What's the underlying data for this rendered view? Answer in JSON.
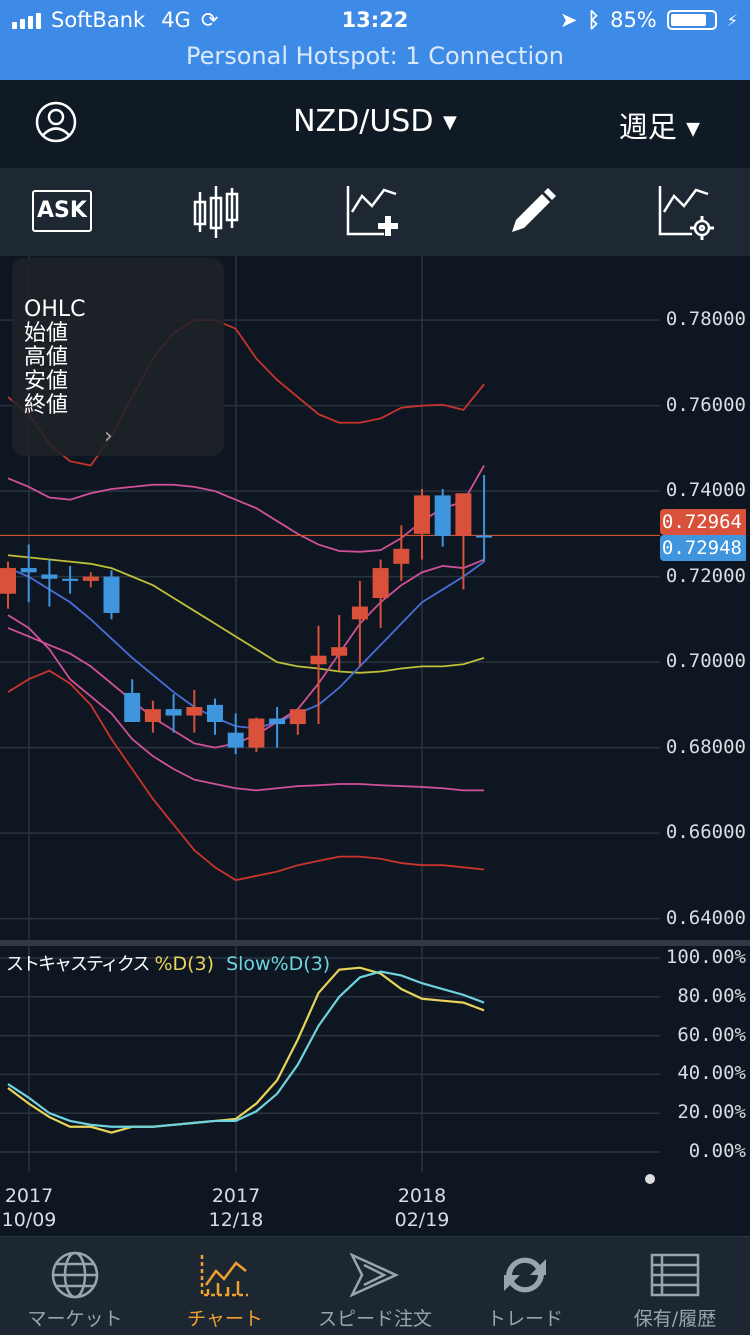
{
  "status_bar": {
    "carrier": "SoftBank",
    "network": "4G",
    "time": "13:22",
    "battery": "85%",
    "battery_level": 0.85,
    "hotspot": "Personal Hotspot: 1 Connection"
  },
  "header": {
    "pair": "NZD/USD",
    "period": "週足",
    "icons": [
      "user-icon",
      "chevron-down-icon"
    ]
  },
  "toolbar": {
    "ask_label": "ASK",
    "icons": [
      "ask-icon",
      "candlestick-icon",
      "add-indicator-icon",
      "pencil-icon",
      "chart-settings-icon"
    ]
  },
  "ohlc_panel": {
    "title": "OHLC",
    "rows": [
      "始値",
      "高値",
      "安値",
      "終値"
    ]
  },
  "price_axis": {
    "ticks": [
      "0.78000",
      "0.76000",
      "0.74000",
      "0.72000",
      "0.70000",
      "0.68000",
      "0.66000",
      "0.64000"
    ],
    "ask_tag": "0.72964",
    "bid_tag": "0.72948",
    "ask_color": "#d9513a",
    "bid_color": "#3f95de"
  },
  "oscillator": {
    "name": "ストキャスティクス",
    "d_label": "%D(3)",
    "slow_label": "Slow%D(3)",
    "d_color": "#e8d45a",
    "slow_color": "#6fd3e0",
    "ticks": [
      "100.00%",
      "80.00%",
      "60.00%",
      "40.00%",
      "20.00%",
      "0.00%"
    ]
  },
  "time_axis": [
    {
      "year": "2017",
      "date": "10/09"
    },
    {
      "year": "2017",
      "date": "12/18"
    },
    {
      "year": "2018",
      "date": "02/19"
    }
  ],
  "tabs": [
    {
      "label": "マーケット",
      "icon": "globe-icon",
      "active": false
    },
    {
      "label": "チャート",
      "icon": "chart-icon",
      "active": true
    },
    {
      "label": "スピード注文",
      "icon": "speed-order-icon",
      "active": false
    },
    {
      "label": "トレード",
      "icon": "trade-icon",
      "active": false
    },
    {
      "label": "保有/履歴",
      "icon": "history-icon",
      "active": false
    }
  ],
  "colors": {
    "up": "#d9513a",
    "down": "#3f95de",
    "active_tab": "#f0a12c",
    "status_bar": "#3d8be7"
  },
  "chart_data": {
    "type": "candlestick",
    "x": [
      "2017/09/11",
      "2017/09/18",
      "2017/09/25",
      "2017/10/02",
      "2017/10/09",
      "2017/10/16",
      "2017/10/23",
      "2017/10/30",
      "2017/11/06",
      "2017/11/13",
      "2017/11/20",
      "2017/11/27",
      "2017/12/04",
      "2017/12/11",
      "2017/12/18",
      "2017/12/25",
      "2018/01/01",
      "2018/01/08",
      "2018/01/15",
      "2018/01/22",
      "2018/01/29",
      "2018/02/05",
      "2018/02/12",
      "2018/02/19"
    ],
    "open": [
      0.716,
      0.722,
      0.7205,
      0.7195,
      0.719,
      0.72,
      0.6928,
      0.686,
      0.689,
      0.6875,
      0.69,
      0.6835,
      0.68,
      0.6868,
      0.6855,
      0.6995,
      0.7015,
      0.71,
      0.715,
      0.723,
      0.73,
      0.739,
      0.7295,
      0.7296
    ],
    "high": [
      0.7235,
      0.7275,
      0.724,
      0.7225,
      0.721,
      0.7215,
      0.696,
      0.691,
      0.6925,
      0.6935,
      0.6915,
      0.688,
      0.687,
      0.6895,
      0.6885,
      0.7085,
      0.711,
      0.719,
      0.724,
      0.732,
      0.7405,
      0.7405,
      0.7385,
      0.7438
    ],
    "low": [
      0.7125,
      0.714,
      0.713,
      0.716,
      0.7175,
      0.71,
      0.6865,
      0.6835,
      0.6835,
      0.6835,
      0.683,
      0.6785,
      0.679,
      0.68,
      0.683,
      0.6855,
      0.698,
      0.699,
      0.708,
      0.719,
      0.724,
      0.727,
      0.717,
      0.7235
    ],
    "close": [
      0.722,
      0.721,
      0.7195,
      0.719,
      0.72,
      0.7115,
      0.686,
      0.689,
      0.6875,
      0.6895,
      0.686,
      0.68,
      0.6868,
      0.6855,
      0.689,
      0.7015,
      0.7035,
      0.713,
      0.722,
      0.7265,
      0.739,
      0.7295,
      0.7395,
      0.7295
    ],
    "ylim": [
      0.635,
      0.795
    ],
    "indicators": {
      "bollinger_upper2": [
        0.762,
        0.758,
        0.751,
        0.747,
        0.746,
        0.753,
        0.762,
        0.771,
        0.777,
        0.78,
        0.78,
        0.778,
        0.771,
        0.766,
        0.762,
        0.758,
        0.756,
        0.756,
        0.757,
        0.7595,
        0.76,
        0.7602,
        0.759,
        0.765
      ],
      "bollinger_upper1": [
        0.743,
        0.741,
        0.7385,
        0.738,
        0.7395,
        0.7405,
        0.741,
        0.7415,
        0.7415,
        0.741,
        0.74,
        0.738,
        0.736,
        0.733,
        0.73,
        0.7275,
        0.726,
        0.7258,
        0.7262,
        0.729,
        0.733,
        0.736,
        0.7375,
        0.746
      ],
      "moving_average": [
        0.725,
        0.7245,
        0.724,
        0.7235,
        0.723,
        0.722,
        0.72,
        0.718,
        0.715,
        0.712,
        0.709,
        0.706,
        0.703,
        0.7,
        0.699,
        0.6985,
        0.6978,
        0.6975,
        0.6978,
        0.6985,
        0.699,
        0.699,
        0.6995,
        0.701
      ],
      "bollinger_lower1": [
        0.711,
        0.708,
        0.703,
        0.696,
        0.692,
        0.688,
        0.682,
        0.678,
        0.675,
        0.6725,
        0.6715,
        0.6705,
        0.67,
        0.6705,
        0.671,
        0.6712,
        0.6715,
        0.6715,
        0.6712,
        0.671,
        0.6708,
        0.6705,
        0.67,
        0.67
      ],
      "bollinger_lower2": [
        0.693,
        0.696,
        0.698,
        0.695,
        0.69,
        0.682,
        0.675,
        0.668,
        0.662,
        0.656,
        0.652,
        0.649,
        0.65,
        0.651,
        0.6525,
        0.6535,
        0.6545,
        0.6545,
        0.654,
        0.653,
        0.6525,
        0.6525,
        0.652,
        0.6515
      ],
      "band_a": [
        0.722,
        0.72,
        0.717,
        0.714,
        0.71,
        0.7055,
        0.701,
        0.697,
        0.693,
        0.6895,
        0.687,
        0.685,
        0.6845,
        0.686,
        0.688,
        0.69,
        0.694,
        0.699,
        0.704,
        0.709,
        0.714,
        0.717,
        0.72,
        0.7235
      ],
      "band_b": [
        0.708,
        0.706,
        0.704,
        0.702,
        0.699,
        0.695,
        0.691,
        0.687,
        0.684,
        0.681,
        0.68,
        0.681,
        0.683,
        0.686,
        0.689,
        0.695,
        0.702,
        0.709,
        0.714,
        0.718,
        0.721,
        0.7225,
        0.722,
        0.724
      ]
    },
    "stochastic": {
      "d": [
        33,
        25,
        18,
        13,
        13,
        10,
        13,
        13,
        14,
        15,
        16,
        17,
        25,
        37,
        58,
        82,
        94,
        95,
        92,
        84,
        79,
        78,
        77,
        73
      ],
      "slow_d": [
        35,
        28,
        20,
        16,
        14,
        13,
        13,
        13,
        14,
        15,
        16,
        16,
        21,
        30,
        45,
        65,
        80,
        90,
        93,
        91,
        87,
        84,
        81,
        77
      ],
      "ylim": [
        0,
        100
      ]
    }
  }
}
